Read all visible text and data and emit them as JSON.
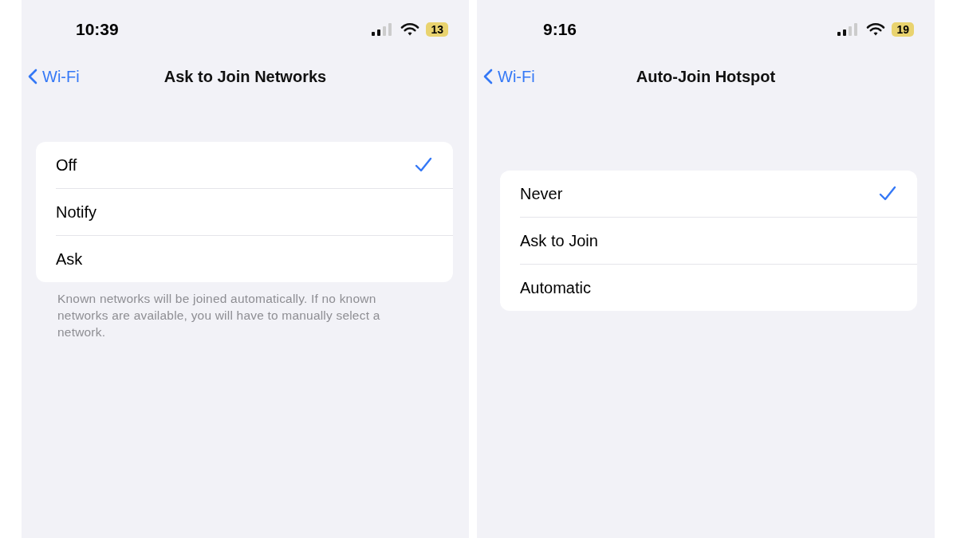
{
  "screens": [
    {
      "status_bar": {
        "time": "10:39",
        "battery": "13"
      },
      "nav": {
        "back": "Wi-Fi",
        "title": "Ask to Join Networks"
      },
      "options": [
        {
          "label": "Off",
          "selected": true
        },
        {
          "label": "Notify",
          "selected": false
        },
        {
          "label": "Ask",
          "selected": false
        }
      ],
      "footer": "Known networks will be joined automatically. If no known networks are available, you will have to manually select a network."
    },
    {
      "status_bar": {
        "time": "9:16",
        "battery": "19"
      },
      "nav": {
        "back": "Wi-Fi",
        "title": "Auto-Join Hotspot"
      },
      "options": [
        {
          "label": "Never",
          "selected": true
        },
        {
          "label": "Ask to Join",
          "selected": false
        },
        {
          "label": "Automatic",
          "selected": false
        }
      ]
    }
  ]
}
